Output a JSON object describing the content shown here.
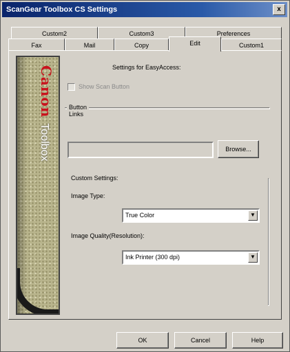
{
  "window": {
    "title": "ScanGear Toolbox CS Settings",
    "close_glyph": "x"
  },
  "tabs_back": [
    {
      "label": "Custom2"
    },
    {
      "label": "Custom3"
    },
    {
      "label": "Preferences"
    }
  ],
  "tabs_front": [
    {
      "label": "Fax"
    },
    {
      "label": "Mail"
    },
    {
      "label": "Copy"
    },
    {
      "label": "Edit"
    },
    {
      "label": "Custom1"
    }
  ],
  "banner": {
    "brand": "Canon",
    "product": "Toolbox"
  },
  "panel": {
    "settings_for": "Settings for EasyAccess:",
    "show_scan_button_label": "Show Scan Button",
    "button_links_legend": "Button Links",
    "browse_label": "Browse...",
    "custom_settings_label": "Custom Settings:",
    "image_type_label": "Image Type:",
    "image_type_value": "True Color",
    "image_quality_label": "Image Quality(Resolution):",
    "image_quality_value": "Ink Printer (300 dpi)"
  },
  "footer": {
    "ok": "OK",
    "cancel": "Cancel",
    "help": "Help"
  },
  "colors": {
    "titlebar": "#0a246a",
    "face": "#d4d0c8",
    "canon_red": "#c8141e"
  }
}
